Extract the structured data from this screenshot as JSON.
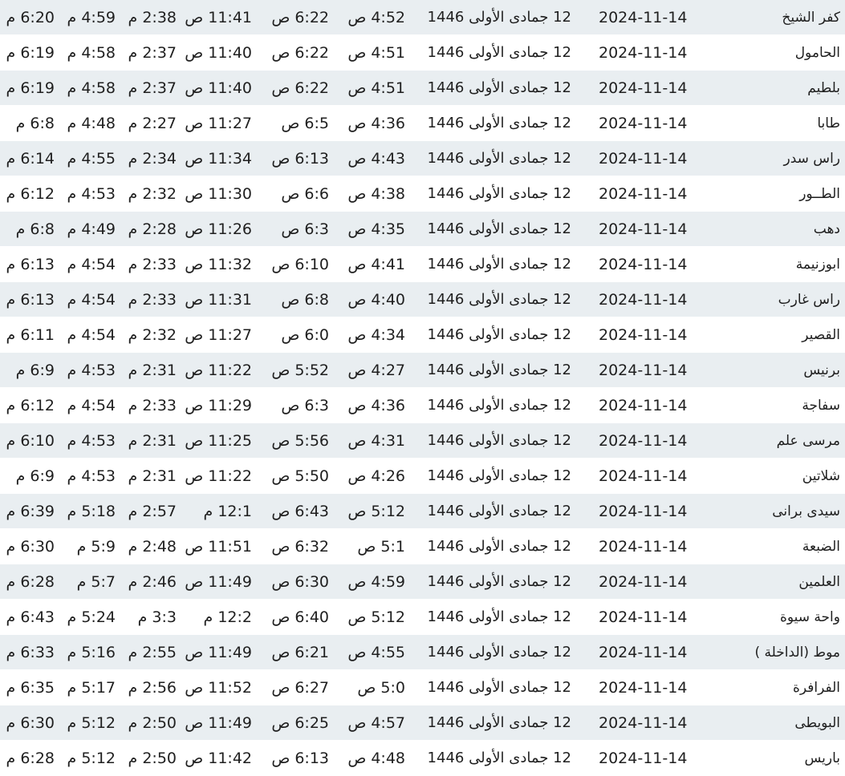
{
  "rows": [
    {
      "city": "كفر الشيخ",
      "gregorian": "2024-11-14",
      "hijri": "12 جمادى الأولى 1446",
      "fajr": "4:52 ص",
      "sunrise": "6:22 ص",
      "dhuhr": "11:41 ص",
      "asr": "2:38 م",
      "maghrib": "4:59 م",
      "isha": "6:20 م"
    },
    {
      "city": "الحامول",
      "gregorian": "2024-11-14",
      "hijri": "12 جمادى الأولى 1446",
      "fajr": "4:51 ص",
      "sunrise": "6:22 ص",
      "dhuhr": "11:40 ص",
      "asr": "2:37 م",
      "maghrib": "4:58 م",
      "isha": "6:19 م"
    },
    {
      "city": "بلطيم",
      "gregorian": "2024-11-14",
      "hijri": "12 جمادى الأولى 1446",
      "fajr": "4:51 ص",
      "sunrise": "6:22 ص",
      "dhuhr": "11:40 ص",
      "asr": "2:37 م",
      "maghrib": "4:58 م",
      "isha": "6:19 م"
    },
    {
      "city": "طابا",
      "gregorian": "2024-11-14",
      "hijri": "12 جمادى الأولى 1446",
      "fajr": "4:36 ص",
      "sunrise": "6:5 ص",
      "dhuhr": "11:27 ص",
      "asr": "2:27 م",
      "maghrib": "4:48 م",
      "isha": "6:8 م"
    },
    {
      "city": "راس سدر",
      "gregorian": "2024-11-14",
      "hijri": "12 جمادى الأولى 1446",
      "fajr": "4:43 ص",
      "sunrise": "6:13 ص",
      "dhuhr": "11:34 ص",
      "asr": "2:34 م",
      "maghrib": "4:55 م",
      "isha": "6:14 م"
    },
    {
      "city": "الطــور",
      "gregorian": "2024-11-14",
      "hijri": "12 جمادى الأولى 1446",
      "fajr": "4:38 ص",
      "sunrise": "6:6 ص",
      "dhuhr": "11:30 ص",
      "asr": "2:32 م",
      "maghrib": "4:53 م",
      "isha": "6:12 م"
    },
    {
      "city": "دهب",
      "gregorian": "2024-11-14",
      "hijri": "12 جمادى الأولى 1446",
      "fajr": "4:35 ص",
      "sunrise": "6:3 ص",
      "dhuhr": "11:26 ص",
      "asr": "2:28 م",
      "maghrib": "4:49 م",
      "isha": "6:8 م"
    },
    {
      "city": "ابوزنيمة",
      "gregorian": "2024-11-14",
      "hijri": "12 جمادى الأولى 1446",
      "fajr": "4:41 ص",
      "sunrise": "6:10 ص",
      "dhuhr": "11:32 ص",
      "asr": "2:33 م",
      "maghrib": "4:54 م",
      "isha": "6:13 م"
    },
    {
      "city": "راس غارب",
      "gregorian": "2024-11-14",
      "hijri": "12 جمادى الأولى 1446",
      "fajr": "4:40 ص",
      "sunrise": "6:8 ص",
      "dhuhr": "11:31 ص",
      "asr": "2:33 م",
      "maghrib": "4:54 م",
      "isha": "6:13 م"
    },
    {
      "city": "القصير",
      "gregorian": "2024-11-14",
      "hijri": "12 جمادى الأولى 1446",
      "fajr": "4:34 ص",
      "sunrise": "6:0 ص",
      "dhuhr": "11:27 ص",
      "asr": "2:32 م",
      "maghrib": "4:54 م",
      "isha": "6:11 م"
    },
    {
      "city": "برنيس",
      "gregorian": "2024-11-14",
      "hijri": "12 جمادى الأولى 1446",
      "fajr": "4:27 ص",
      "sunrise": "5:52 ص",
      "dhuhr": "11:22 ص",
      "asr": "2:31 م",
      "maghrib": "4:53 م",
      "isha": "6:9 م"
    },
    {
      "city": "سفاجة",
      "gregorian": "2024-11-14",
      "hijri": "12 جمادى الأولى 1446",
      "fajr": "4:36 ص",
      "sunrise": "6:3 ص",
      "dhuhr": "11:29 ص",
      "asr": "2:33 م",
      "maghrib": "4:54 م",
      "isha": "6:12 م"
    },
    {
      "city": "مرسى علم",
      "gregorian": "2024-11-14",
      "hijri": "12 جمادى الأولى 1446",
      "fajr": "4:31 ص",
      "sunrise": "5:56 ص",
      "dhuhr": "11:25 ص",
      "asr": "2:31 م",
      "maghrib": "4:53 م",
      "isha": "6:10 م"
    },
    {
      "city": "شلاتين",
      "gregorian": "2024-11-14",
      "hijri": "12 جمادى الأولى 1446",
      "fajr": "4:26 ص",
      "sunrise": "5:50 ص",
      "dhuhr": "11:22 ص",
      "asr": "2:31 م",
      "maghrib": "4:53 م",
      "isha": "6:9 م"
    },
    {
      "city": "سيدى برانى",
      "gregorian": "2024-11-14",
      "hijri": "12 جمادى الأولى 1446",
      "fajr": "5:12 ص",
      "sunrise": "6:43 ص",
      "dhuhr": "12:1 م",
      "asr": "2:57 م",
      "maghrib": "5:18 م",
      "isha": "6:39 م"
    },
    {
      "city": "الضبعة",
      "gregorian": "2024-11-14",
      "hijri": "12 جمادى الأولى 1446",
      "fajr": "5:1 ص",
      "sunrise": "6:32 ص",
      "dhuhr": "11:51 ص",
      "asr": "2:48 م",
      "maghrib": "5:9 م",
      "isha": "6:30 م"
    },
    {
      "city": "العلمين",
      "gregorian": "2024-11-14",
      "hijri": "12 جمادى الأولى 1446",
      "fajr": "4:59 ص",
      "sunrise": "6:30 ص",
      "dhuhr": "11:49 ص",
      "asr": "2:46 م",
      "maghrib": "5:7 م",
      "isha": "6:28 م"
    },
    {
      "city": "واحة سيوة",
      "gregorian": "2024-11-14",
      "hijri": "12 جمادى الأولى 1446",
      "fajr": "5:12 ص",
      "sunrise": "6:40 ص",
      "dhuhr": "12:2 م",
      "asr": "3:3 م",
      "maghrib": "5:24 م",
      "isha": "6:43 م"
    },
    {
      "city": "موط (الداخلة )",
      "gregorian": "2024-11-14",
      "hijri": "12 جمادى الأولى 1446",
      "fajr": "4:55 ص",
      "sunrise": "6:21 ص",
      "dhuhr": "11:49 ص",
      "asr": "2:55 م",
      "maghrib": "5:16 م",
      "isha": "6:33 م"
    },
    {
      "city": "الفرافرة",
      "gregorian": "2024-11-14",
      "hijri": "12 جمادى الأولى 1446",
      "fajr": "5:0 ص",
      "sunrise": "6:27 ص",
      "dhuhr": "11:52 ص",
      "asr": "2:56 م",
      "maghrib": "5:17 م",
      "isha": "6:35 م"
    },
    {
      "city": "البويطى",
      "gregorian": "2024-11-14",
      "hijri": "12 جمادى الأولى 1446",
      "fajr": "4:57 ص",
      "sunrise": "6:25 ص",
      "dhuhr": "11:49 ص",
      "asr": "2:50 م",
      "maghrib": "5:12 م",
      "isha": "6:30 م"
    },
    {
      "city": "باريس",
      "gregorian": "2024-11-14",
      "hijri": "12 جمادى الأولى 1446",
      "fajr": "4:48 ص",
      "sunrise": "6:13 ص",
      "dhuhr": "11:42 ص",
      "asr": "2:50 م",
      "maghrib": "5:12 م",
      "isha": "6:28 م"
    }
  ]
}
